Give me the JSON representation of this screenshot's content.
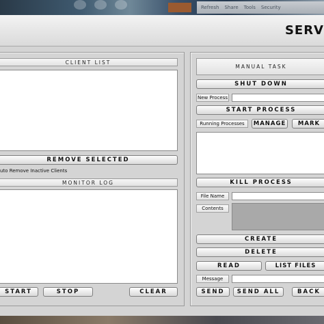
{
  "window": {
    "title": "SERV"
  },
  "desktop_bar": {
    "items": [
      "Refresh",
      "Share",
      "Tools",
      "Security"
    ]
  },
  "left_panel": {
    "client_list_header": "CLIENT LIST",
    "remove_selected_label": "REMOVE SELECTED",
    "auto_remove_label": "uto Remove Inactive Clients",
    "monitor_log_header": "MONITOR LOG",
    "start_label": "START",
    "stop_label": "STOP",
    "clear_label": "CLEAR"
  },
  "right_panel": {
    "manual_task_header": "MANUAL TASK",
    "shut_down_label": "SHUT DOWN",
    "new_process_label": "New Process",
    "new_process_value": "",
    "start_process_label": "START PROCESS",
    "running_processes_label": "Running Processes",
    "manage_label": "MANAGE",
    "mark_label": "MARK",
    "kill_process_label": "KILL PROCESS",
    "file_name_label": "File Name",
    "file_name_value": "",
    "contents_label": "Contents",
    "create_label": "CREATE",
    "delete_label": "DELETE",
    "read_label": "READ",
    "list_files_label": "LIST FILES",
    "message_label": "Message",
    "message_value": "",
    "send_label": "SEND",
    "send_all_label": "SEND ALL",
    "back_label": "BACK"
  }
}
